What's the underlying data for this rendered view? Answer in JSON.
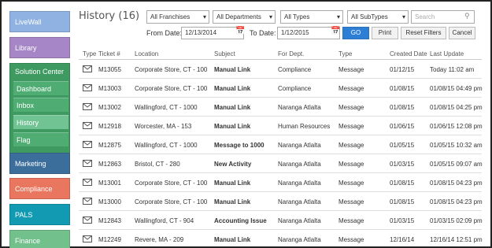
{
  "sidebar": {
    "livewall": "LiveWall",
    "library": "Library",
    "solution_center": "Solution Center",
    "sub_items": [
      "Dashboard",
      "Inbox",
      "History",
      "Flag"
    ],
    "marketing": "Marketing",
    "compliance": "Compliance",
    "pals": "PALS",
    "finance": "Finance"
  },
  "header": {
    "title": "History (16)",
    "filters": {
      "franchises": "All Franchises",
      "departments": "All Departments",
      "types": "All Types",
      "subtypes": "All SubTypes"
    },
    "search_placeholder": "Search",
    "from_label": "From Date:",
    "from_value": "12/13/2014",
    "to_label": "To Date:",
    "to_value": "1/12/2015",
    "go": "GO",
    "print": "Print",
    "reset": "Reset Filters",
    "cancel": "Cancel"
  },
  "table": {
    "columns": [
      "Type",
      "Ticket #",
      "Location",
      "Subject",
      "For Dept.",
      "Type",
      "Created Date",
      "Last Update"
    ],
    "rows": [
      {
        "ticket": "M13055",
        "location": "Corporate Store, CT - 100",
        "subject": "Manual Link",
        "dept": "Compliance",
        "type": "Message",
        "created": "01/12/15",
        "updated": "Today 11:02 am"
      },
      {
        "ticket": "M13003",
        "location": "Corporate Store, CT - 100",
        "subject": "Manual Link",
        "dept": "Compliance",
        "type": "Message",
        "created": "01/08/15",
        "updated": "01/08/15 04:49 pm"
      },
      {
        "ticket": "M13002",
        "location": "Wallingford, CT - 1000",
        "subject": "Manual Link",
        "dept": "Naranga Atlalta",
        "type": "Message",
        "created": "01/08/15",
        "updated": "01/08/15 04:25 pm"
      },
      {
        "ticket": "M12918",
        "location": "Worcester, MA - 153",
        "subject": "Manual Link",
        "dept": "Human Resources",
        "type": "Message",
        "created": "01/06/15",
        "updated": "01/06/15 12:08 pm"
      },
      {
        "ticket": "M12875",
        "location": "Wallingford, CT - 1000",
        "subject": "Message to 1000",
        "dept": "Naranga Atlalta",
        "type": "Message",
        "created": "01/05/15",
        "updated": "01/05/15 10:32 am"
      },
      {
        "ticket": "M12863",
        "location": "Bristol, CT - 280",
        "subject": "New Activity",
        "dept": "Naranga Atlalta",
        "type": "Message",
        "created": "01/03/15",
        "updated": "01/05/15 09:07 am"
      },
      {
        "ticket": "M13001",
        "location": "Corporate Store, CT - 100",
        "subject": "Manual Link",
        "dept": "Naranga Atlalta",
        "type": "Message",
        "created": "01/08/15",
        "updated": "01/08/15 04:23 pm"
      },
      {
        "ticket": "M13000",
        "location": "Corporate Store, CT - 100",
        "subject": "Manual Link",
        "dept": "Naranga Atlalta",
        "type": "Message",
        "created": "01/08/15",
        "updated": "01/08/15 04:23 pm"
      },
      {
        "ticket": "M12843",
        "location": "Wallingford, CT - 904",
        "subject": "Accounting Issue",
        "dept": "Naranga Atlalta",
        "type": "Message",
        "created": "01/03/15",
        "updated": "01/03/15 02:09 pm"
      },
      {
        "ticket": "M12249",
        "location": "Revere, MA - 209",
        "subject": "Manual Link",
        "dept": "Naranga Atlalta",
        "type": "Message",
        "created": "12/16/14",
        "updated": "12/16/14 12:51 pm"
      }
    ]
  },
  "colors": {
    "livewall": "#8fb2e2",
    "library": "#a686c6",
    "solution_center": "#3f9a62",
    "marketing": "#3c6e9c",
    "compliance": "#e9765e",
    "pals": "#119ab2",
    "finance": "#72c08c",
    "go_button": "#2d7fd6"
  }
}
